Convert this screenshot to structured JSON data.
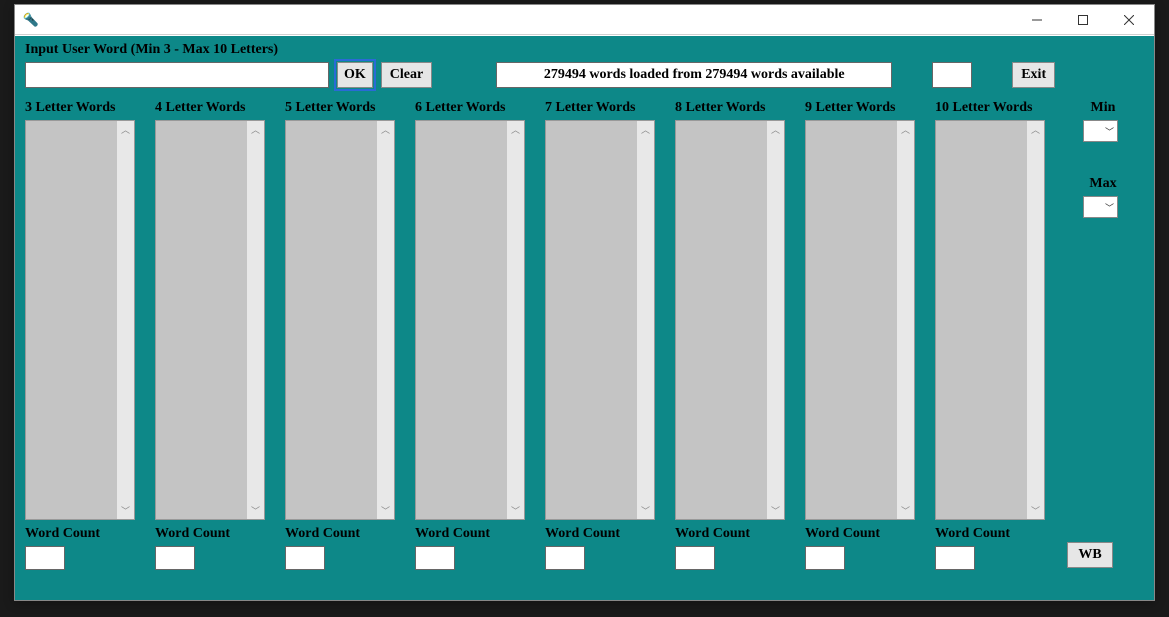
{
  "window": {
    "title": ""
  },
  "input_section": {
    "label": "Input User Word (Min 3 - Max 10 Letters)",
    "value": "",
    "ok_label": "OK",
    "clear_label": "Clear",
    "status_text": "279494 words loaded from 279494  words available",
    "small_value": "",
    "exit_label": "Exit"
  },
  "columns": [
    {
      "header": "3 Letter Words",
      "wc_label": "Word Count",
      "wc_value": ""
    },
    {
      "header": "4 Letter Words",
      "wc_label": "Word Count",
      "wc_value": ""
    },
    {
      "header": "5 Letter Words",
      "wc_label": "Word Count",
      "wc_value": ""
    },
    {
      "header": "6 Letter Words",
      "wc_label": "Word Count",
      "wc_value": ""
    },
    {
      "header": "7 Letter Words",
      "wc_label": "Word Count",
      "wc_value": ""
    },
    {
      "header": "8 Letter Words",
      "wc_label": "Word Count",
      "wc_value": ""
    },
    {
      "header": "9 Letter Words",
      "wc_label": "Word Count",
      "wc_value": ""
    },
    {
      "header": "10 Letter Words",
      "wc_label": "Word Count",
      "wc_value": ""
    }
  ],
  "right_panel": {
    "min_label": "Min",
    "min_value": "",
    "max_label": "Max",
    "max_value": "",
    "wb_label": "WB"
  }
}
